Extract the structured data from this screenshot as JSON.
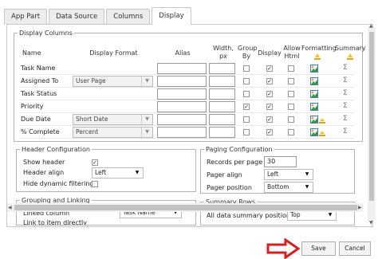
{
  "tabs": [
    "App Part",
    "Data Source",
    "Columns",
    "Display"
  ],
  "display_columns": {
    "legend": "Display Columns",
    "headers": {
      "name": "Name",
      "display_format": "Display Format",
      "alias": "Alias",
      "width": "Width, px",
      "group_by": "Group By",
      "display": "Display",
      "allow_html": "Allow Html",
      "formatting": "Formatting",
      "summary": "Summary"
    },
    "rows": [
      {
        "name": "Task Name",
        "format": "",
        "group_by": false,
        "display": true,
        "allow_html": false,
        "wand": false
      },
      {
        "name": "Assigned To",
        "format": "User Page",
        "group_by": false,
        "display": true,
        "allow_html": false,
        "wand": false
      },
      {
        "name": "Task Status",
        "format": "",
        "group_by": false,
        "display": true,
        "allow_html": false,
        "wand": false
      },
      {
        "name": "Priority",
        "format": "",
        "group_by": true,
        "display": true,
        "allow_html": false,
        "wand": false
      },
      {
        "name": "Due Date",
        "format": "Short Date",
        "group_by": false,
        "display": true,
        "allow_html": false,
        "wand": true
      },
      {
        "name": "% Complete",
        "format": "Percent",
        "group_by": false,
        "display": true,
        "allow_html": false,
        "wand": true
      }
    ]
  },
  "header_config": {
    "legend": "Header Configuration",
    "show_header_label": "Show header",
    "show_header": true,
    "header_align_label": "Header align",
    "header_align": "Left",
    "hide_filtering_label": "Hide dynamic filtering",
    "hide_filtering": false
  },
  "grouping": {
    "legend": "Grouping and Linking",
    "linked_column_label": "Linked column",
    "linked_column": "Task Name",
    "link_label": "Link to item directly"
  },
  "paging": {
    "legend": "Paging Configuration",
    "records_label": "Records per page",
    "records": "30",
    "pager_align_label": "Pager align",
    "pager_align": "Left",
    "pager_position_label": "Pager position",
    "pager_position": "Bottom"
  },
  "summary_rows": {
    "legend": "Summary Rows",
    "position_label": "All data summary position",
    "position": "Top"
  },
  "buttons": {
    "save": "Save",
    "cancel": "Cancel"
  },
  "colors": {
    "arrow": "#d42020"
  }
}
